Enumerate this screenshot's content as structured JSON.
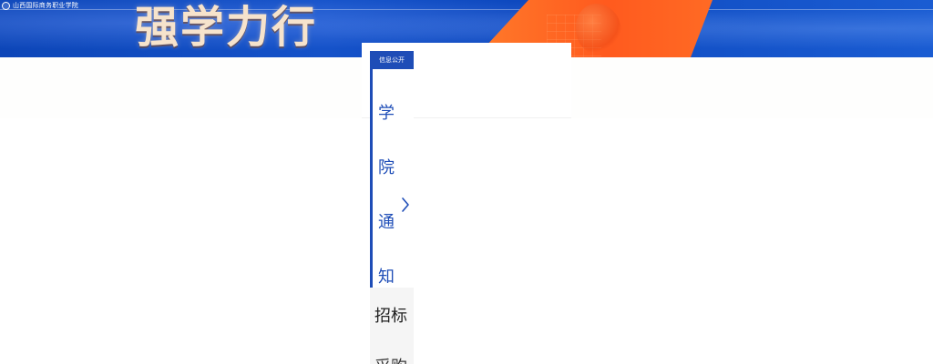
{
  "banner": {
    "school_name": "山西国际商务职业学院",
    "slogan": "强学力行",
    "colors": {
      "banner_blue": "#1552c9",
      "wedge_orange": "#ff5a1e",
      "slogan_cream": "#f6e3cc"
    },
    "icons": {
      "school_seal": "school-seal-icon"
    }
  },
  "sidebar": {
    "header_label": "信息公开",
    "active_item": {
      "chars": [
        "学",
        "院",
        "通",
        "知"
      ],
      "chevron_icon": "chevron-right-icon",
      "accent_color": "#1e4db7"
    },
    "next_item": {
      "label": "招标",
      "more": "采购"
    }
  }
}
